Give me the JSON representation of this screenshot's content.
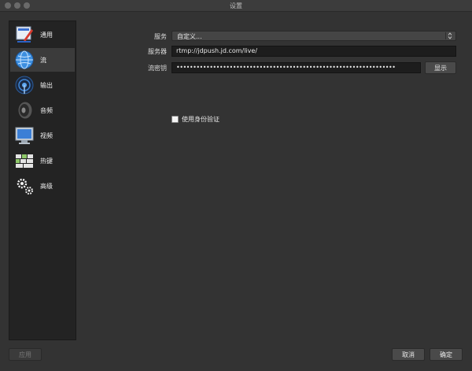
{
  "window": {
    "title": "设置"
  },
  "sidebar": {
    "items": [
      {
        "label": "通用",
        "icon": "general-icon",
        "active": false
      },
      {
        "label": "流",
        "icon": "stream-globe-icon",
        "active": true
      },
      {
        "label": "输出",
        "icon": "output-broadcast-icon",
        "active": false
      },
      {
        "label": "音频",
        "icon": "audio-speaker-icon",
        "active": false
      },
      {
        "label": "视频",
        "icon": "video-monitor-icon",
        "active": false
      },
      {
        "label": "热键",
        "icon": "hotkeys-keyboard-icon",
        "active": false
      },
      {
        "label": "高级",
        "icon": "advanced-gears-icon",
        "active": false
      }
    ]
  },
  "stream": {
    "service_label": "服务",
    "service_value": "自定义...",
    "server_label": "服务器",
    "server_value": "rtmp://jdpush.jd.com/live/",
    "key_label": "流密钥",
    "key_value": "••••••••••••••••••••••••••••••••••••••••••••••••••••••••••••••••••",
    "show_button": "显示",
    "auth_label": "使用身份验证",
    "auth_checked": false
  },
  "footer": {
    "apply_button": "应用",
    "cancel_button": "取消",
    "ok_button": "确定"
  },
  "colors": {
    "background": "#333333",
    "sidebar": "#232323",
    "input": "#1d1d1d",
    "button": "#4a4a4a"
  }
}
